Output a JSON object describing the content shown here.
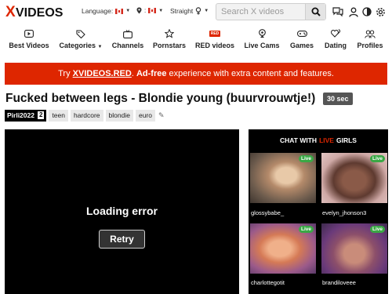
{
  "header": {
    "logo_text": "XVIDEOS",
    "language_label": "Language:",
    "orientation_label": "Straight",
    "search_placeholder": "Search X videos",
    "icons": [
      "search-icon",
      "chat-icon",
      "user-icon",
      "contrast-icon",
      "gear-icon"
    ]
  },
  "nav": {
    "items": [
      {
        "label": "Best Videos",
        "icon": "play-icon"
      },
      {
        "label": "Categories",
        "icon": "tag-icon"
      },
      {
        "label": "Channels",
        "icon": "tv-icon"
      },
      {
        "label": "Pornstars",
        "icon": "star-icon"
      },
      {
        "label": "RED videos",
        "icon": "red-badge",
        "badge": "RED"
      },
      {
        "label": "Live Cams",
        "icon": "webcam-icon"
      },
      {
        "label": "Games",
        "icon": "gamepad-icon"
      },
      {
        "label": "Dating",
        "icon": "hearts-icon"
      },
      {
        "label": "Profiles",
        "icon": "profiles-icon"
      }
    ]
  },
  "banner": {
    "prefix": "Try ",
    "brand": "XVIDEOS.RED",
    "adfree": "Ad-free",
    "suffix": " experience with extra content and features."
  },
  "video": {
    "title": "Fucked between legs - Blondie young (buurvrouwtje!)",
    "duration": "30 sec",
    "uploader": "Pirli2022",
    "uploader_count": "2",
    "tags": [
      "teen",
      "hardcore",
      "blondie",
      "euro"
    ],
    "error_text": "Loading error",
    "retry_label": "Retry"
  },
  "live": {
    "heading_prefix": "CHAT WITH",
    "heading_highlight": "LIVE",
    "heading_suffix": "GIRLS",
    "badge_label": "Live",
    "cams": [
      {
        "name": "glossybabe_"
      },
      {
        "name": "evelyn_jhonson3"
      },
      {
        "name": "charlottegotit"
      },
      {
        "name": "brandiloveee"
      }
    ]
  },
  "colors": {
    "accent_red": "#de2600",
    "live_green": "#3aa845"
  }
}
